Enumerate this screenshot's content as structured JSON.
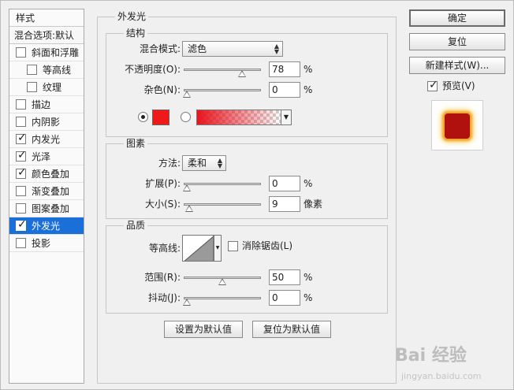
{
  "style_list": {
    "header": "样式",
    "blend_options": "混合选项:默认",
    "items": [
      {
        "label": "斜面和浮雕",
        "checked": false
      },
      {
        "label": "等高线",
        "checked": false
      },
      {
        "label": "纹理",
        "checked": false
      },
      {
        "label": "描边",
        "checked": false
      },
      {
        "label": "内阴影",
        "checked": false
      },
      {
        "label": "内发光",
        "checked": true
      },
      {
        "label": "光泽",
        "checked": true
      },
      {
        "label": "颜色叠加",
        "checked": true
      },
      {
        "label": "渐变叠加",
        "checked": false
      },
      {
        "label": "图案叠加",
        "checked": false
      },
      {
        "label": "外发光",
        "checked": true,
        "selected": true
      },
      {
        "label": "投影",
        "checked": false
      }
    ]
  },
  "panel": {
    "title": "外发光",
    "structure": {
      "title": "结构",
      "blend_mode_label": "混合模式:",
      "blend_mode_value": "滤色",
      "opacity_label": "不透明度(O):",
      "opacity_value": "78",
      "opacity_unit": "%",
      "opacity_level": 0.78,
      "noise_label": "杂色(N):",
      "noise_value": "0",
      "noise_unit": "%",
      "noise_level": 0,
      "color": "#f01818"
    },
    "elements": {
      "title": "图素",
      "technique_label": "方法:",
      "technique_value": "柔和",
      "spread_label": "扩展(P):",
      "spread_value": "0",
      "spread_unit": "%",
      "spread_level": 0,
      "size_label": "大小(S):",
      "size_value": "9",
      "size_unit": "像素",
      "size_level": 0.036
    },
    "quality": {
      "title": "品质",
      "contour_label": "等高线:",
      "antialias_label": "消除锯齿(L)",
      "range_label": "范围(R):",
      "range_value": "50",
      "range_unit": "%",
      "range_level": 0.5,
      "jitter_label": "抖动(J):",
      "jitter_value": "0",
      "jitter_unit": "%",
      "jitter_level": 0
    },
    "make_default": "设置为默认值",
    "reset_default": "复位为默认值"
  },
  "buttons": {
    "ok": "确定",
    "reset": "复位",
    "new_style": "新建样式(W)...",
    "preview_label": "预览(V)",
    "preview_checked": true
  },
  "watermark": {
    "text": "Bai 经验",
    "sub": "jingyan.baidu.com"
  }
}
